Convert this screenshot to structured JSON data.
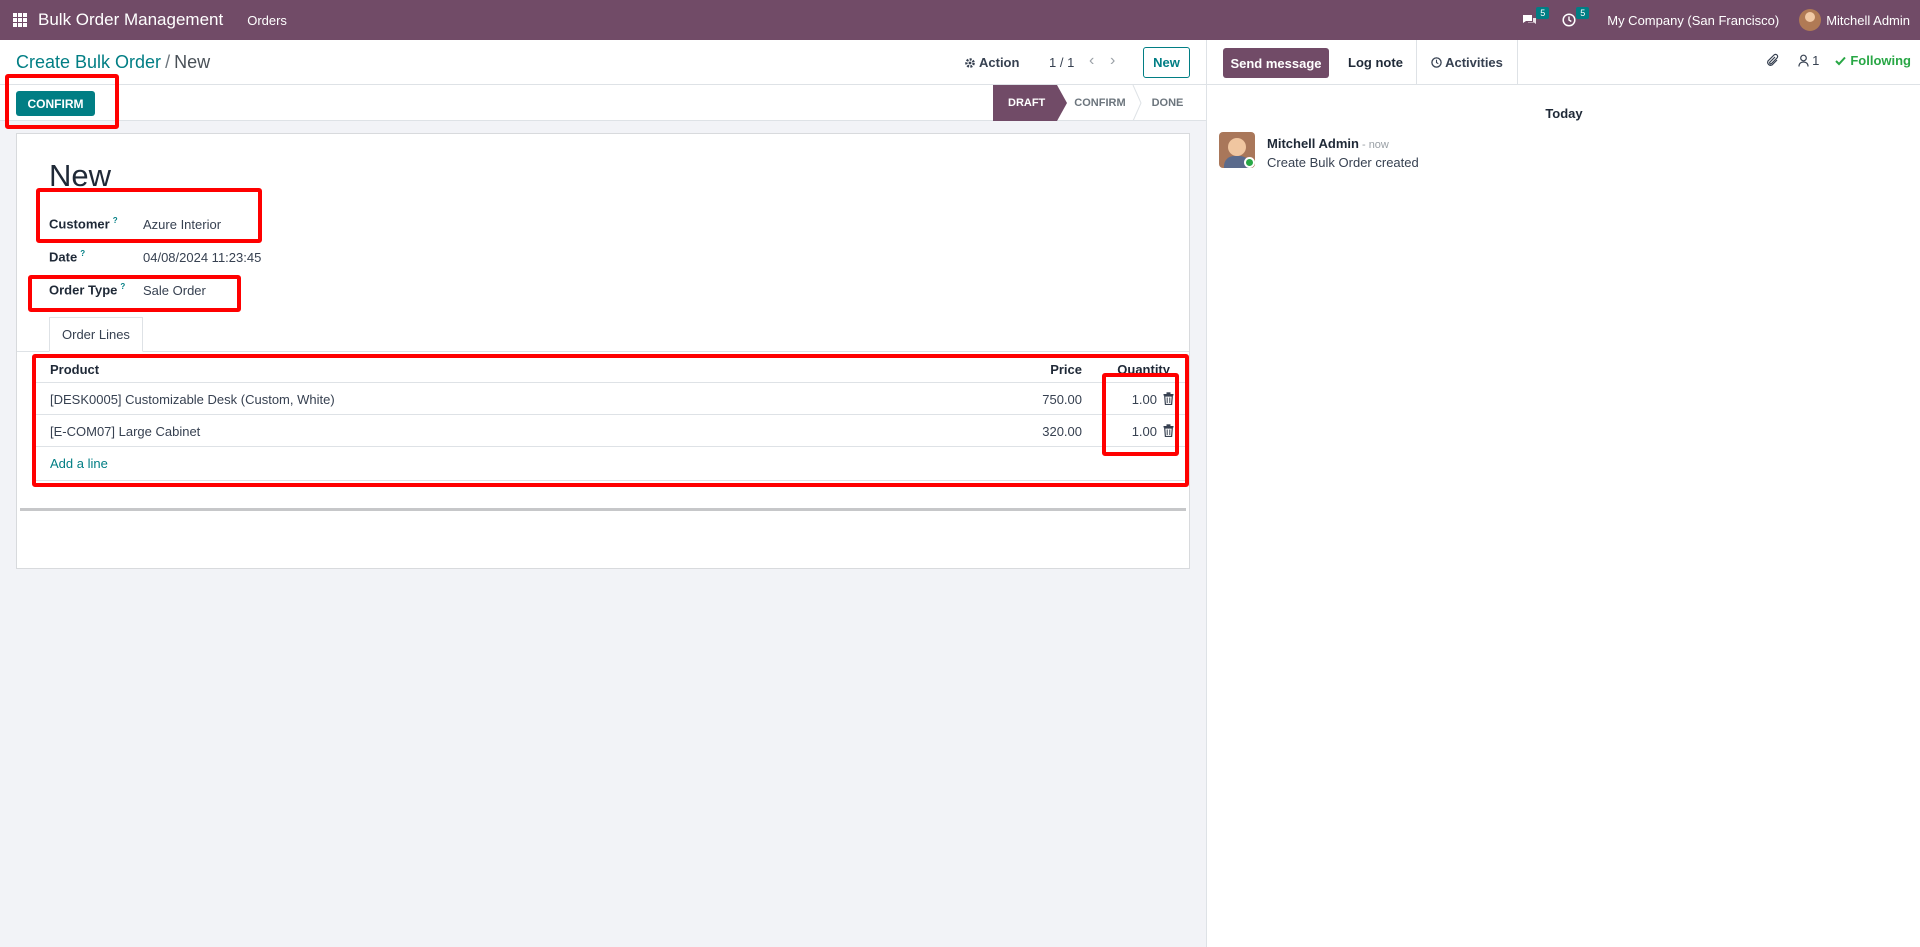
{
  "navbar": {
    "brand": "Bulk Order Management",
    "menu": [
      "Orders"
    ],
    "messages_count": "5",
    "activities_count": "5",
    "company": "My Company (San Francisco)",
    "user": "Mitchell Admin",
    "color": "#714b67"
  },
  "control": {
    "breadcrumb_parent": "Create Bulk Order",
    "breadcrumb_sep": "/",
    "breadcrumb_current": "New",
    "action_label": "Action",
    "pager": "1 / 1",
    "new_label": "New"
  },
  "statusbar": {
    "confirm_label": "CONFIRM",
    "stages": [
      "DRAFT",
      "CONFIRM",
      "DONE"
    ],
    "active_stage": "DRAFT"
  },
  "form": {
    "title": "New",
    "fields": {
      "customer_label": "Customer",
      "customer_value": "Azure Interior",
      "date_label": "Date",
      "date_value": "04/08/2024 11:23:45",
      "order_type_label": "Order Type",
      "order_type_value": "Sale Order",
      "help_mark": "?"
    },
    "tab_label": "Order Lines",
    "table": {
      "headers": [
        "Product",
        "Price",
        "Quantity"
      ],
      "rows": [
        {
          "product": "[DESK0005] Customizable Desk (Custom, White)",
          "price": "750.00",
          "quantity": "1.00"
        },
        {
          "product": "[E-COM07] Large Cabinet",
          "price": "320.00",
          "quantity": "1.00"
        }
      ],
      "add_line": "Add a line"
    }
  },
  "chatter": {
    "send_message": "Send message",
    "log_note": "Log note",
    "activities": "Activities",
    "followers_count": "1",
    "following": "Following",
    "date_separator": "Today",
    "messages": [
      {
        "author": "Mitchell Admin",
        "time": "- now",
        "body": "Create Bulk Order created"
      }
    ]
  },
  "colors": {
    "primary": "#017e84",
    "brand": "#714b67",
    "highlight": "#ff0000",
    "following": "#28a745"
  }
}
